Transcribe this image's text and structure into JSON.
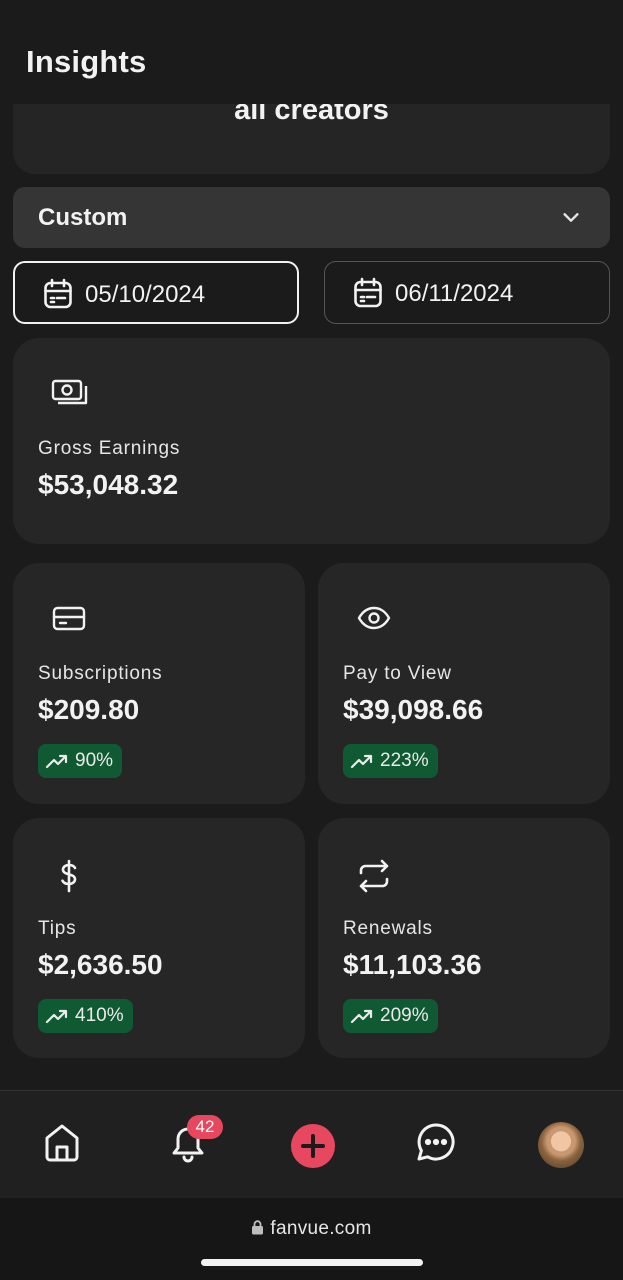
{
  "header": {
    "title": "Insights"
  },
  "scope": {
    "text": "all creators"
  },
  "range": {
    "selected": "Custom"
  },
  "dates": {
    "start": "05/10/2024",
    "end": "06/11/2024"
  },
  "gross": {
    "label": "Gross Earnings",
    "value": "$53,048.32"
  },
  "stats": {
    "subscriptions": {
      "label": "Subscriptions",
      "value": "$209.80",
      "change": "90%"
    },
    "pay_to_view": {
      "label": "Pay to View",
      "value": "$39,098.66",
      "change": "223%"
    },
    "tips": {
      "label": "Tips",
      "value": "$2,636.50",
      "change": "410%"
    },
    "renewals": {
      "label": "Renewals",
      "value": "$11,103.36",
      "change": "209%"
    }
  },
  "nav": {
    "notification_count": "42"
  },
  "browser": {
    "url": "fanvue.com"
  },
  "colors": {
    "accent": "#e8485f",
    "positive_badge": "#0f5a32",
    "card": "#262626",
    "background": "#1b1b1b"
  }
}
